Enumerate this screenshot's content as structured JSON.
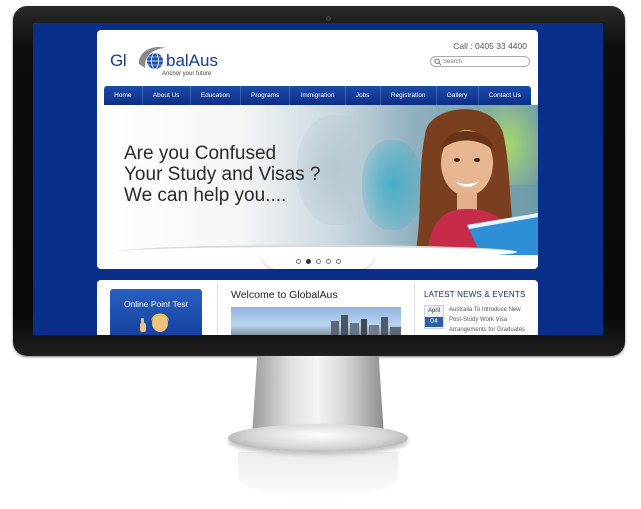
{
  "site": {
    "logo": {
      "prefix": "Gl",
      "suffix": "balAus",
      "tagline": "Anchor your future"
    },
    "call": "Call : 0405 33 4400",
    "search": {
      "placeholder": "Search"
    },
    "nav": [
      {
        "label": "Home"
      },
      {
        "label": "About Us"
      },
      {
        "label": "Education"
      },
      {
        "label": "Programs"
      },
      {
        "label": "Immigration"
      },
      {
        "label": "Jobs"
      },
      {
        "label": "Registration"
      },
      {
        "label": "Gallery"
      },
      {
        "label": "Contact Us"
      }
    ],
    "hero": {
      "lines": [
        "Are you Confused",
        "Your Study and Visas ?",
        "We can help you...."
      ]
    },
    "slider": {
      "dots": 5,
      "active_index": 1
    },
    "online_test": {
      "title": "Online Point Test"
    },
    "welcome": {
      "title": "Welcome to GlobalAus"
    },
    "news": {
      "title": "LATEST NEWS & EVENTS",
      "items": [
        {
          "month": "April",
          "day": "04",
          "lines": [
            "Australia To Introduce New",
            "Post-Study Work Visa",
            "Arrangements for Graduates"
          ]
        }
      ]
    }
  },
  "colors": {
    "brand_blue": "#0a2f8a",
    "nav_blue": "#1f4aa8",
    "news_date_blue": "#2c5fa8"
  }
}
